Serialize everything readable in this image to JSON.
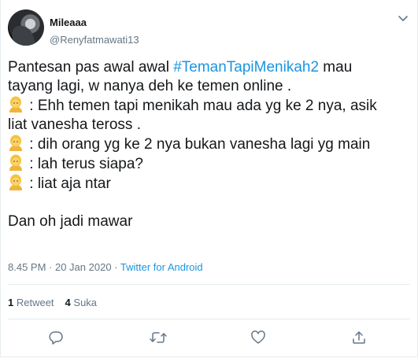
{
  "user": {
    "display_name": "Mileaaa",
    "handle": "@Renyfatmawati13"
  },
  "tweet": {
    "line1_prefix": "Pantesan pas awal awal ",
    "line1_hashtag": "#TemanTapiMenikah2",
    "line1_suffix": " mau",
    "line2": "tayang lagi, w nanya deh ke temen online .",
    "line3": " : Ehh temen tapi menikah mau ada yg ke 2 nya, asik",
    "line4": "liat vanesha teross .",
    "line5": " : dih orang yg ke 2 nya bukan vanesha lagi yg main",
    "line6": " : lah terus siapa?",
    "line7": " : liat aja ntar",
    "line8": "Dan oh jadi mawar",
    "emoji_icon": "person-emoji"
  },
  "meta": {
    "time": "8.45 PM",
    "separator": " · ",
    "date": "20 Jan 2020",
    "source": "Twitter for Android"
  },
  "stats": {
    "retweet_count": "1",
    "retweet_label": " Retweet",
    "like_count": "4",
    "like_label": " Suka"
  },
  "actions": [
    "reply-icon",
    "retweet-icon",
    "like-icon",
    "share-icon"
  ],
  "colors": {
    "link": "#1b95e0",
    "secondary_text": "#657786",
    "primary_text": "#14171a",
    "divider": "#e6ecf0"
  }
}
